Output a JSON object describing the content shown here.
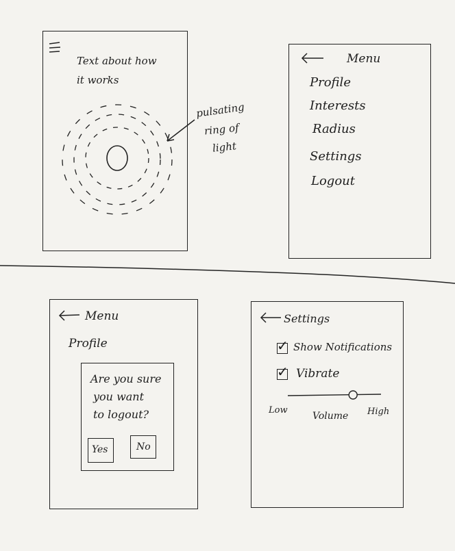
{
  "screen1": {
    "intro_line1": "Text about how",
    "intro_line2": "it works",
    "annotation_line1": "pulsating",
    "annotation_line2": "ring of",
    "annotation_line3": "light",
    "icons": [
      "hamburger-menu-icon",
      "pulsating-ring",
      "arrow-icon"
    ]
  },
  "screen2": {
    "header_label": "Menu",
    "items": [
      {
        "label": "Profile"
      },
      {
        "label": "Interests"
      },
      {
        "label": "Radius"
      },
      {
        "label": "Settings"
      },
      {
        "label": "Logout"
      }
    ],
    "icons": [
      "back-arrow-icon"
    ]
  },
  "screen3": {
    "header_label": "Menu",
    "item_profile": "Profile",
    "dialog": {
      "line1": "Are you sure",
      "line2": "you want",
      "line3": "to logout?",
      "yes_label": "Yes",
      "no_label": "No"
    },
    "icons": [
      "back-arrow-icon"
    ]
  },
  "screen4": {
    "header_label": "Settings",
    "show_notifications_label": "Show Notifications",
    "show_notifications_checked": true,
    "vibrate_label": "Vibrate",
    "vibrate_checked": true,
    "volume_label": "Volume",
    "low_label": "Low",
    "high_label": "High",
    "volume_level": 0.7,
    "icons": [
      "back-arrow-icon",
      "check-icon"
    ]
  }
}
